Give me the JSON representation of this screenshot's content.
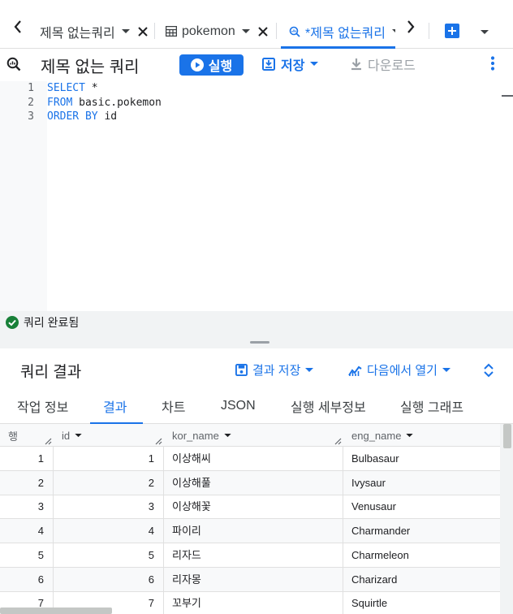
{
  "tabs": [
    {
      "label": "제목 없는쿼리",
      "icon": "none",
      "active": false
    },
    {
      "label": "pokemon",
      "icon": "table-icon",
      "active": false
    },
    {
      "label": "*제목 없는쿼리",
      "icon": "query-icon",
      "active": true
    }
  ],
  "toolbar": {
    "title": "제목 없는 쿼리",
    "run_label": "실행",
    "save_label": "저장",
    "download_label": "다운로드"
  },
  "editor": {
    "lines": [
      {
        "num": "1",
        "tokens": [
          {
            "t": "SELECT",
            "kw": true
          },
          {
            "t": " *",
            "kw": false
          }
        ]
      },
      {
        "num": "2",
        "tokens": [
          {
            "t": "FROM",
            "kw": true
          },
          {
            "t": " basic.pokemon",
            "kw": false
          }
        ]
      },
      {
        "num": "3",
        "tokens": [
          {
            "t": "ORDER BY",
            "kw": true
          },
          {
            "t": " id",
            "kw": false
          }
        ]
      }
    ]
  },
  "status": {
    "text": "쿼리 완료됨"
  },
  "results": {
    "title": "쿼리 결과",
    "save_results_label": "결과 저장",
    "open_in_label": "다음에서 열기",
    "tabs": [
      "작업 정보",
      "결과",
      "차트",
      "JSON",
      "실행 세부정보",
      "실행 그래프"
    ],
    "active_tab": 1,
    "columns": [
      "행",
      "id",
      "kor_name",
      "eng_name"
    ],
    "rows": [
      [
        "1",
        "1",
        "이상해씨",
        "Bulbasaur"
      ],
      [
        "2",
        "2",
        "이상해풀",
        "Ivysaur"
      ],
      [
        "3",
        "3",
        "이상해꽃",
        "Venusaur"
      ],
      [
        "4",
        "4",
        "파이리",
        "Charmander"
      ],
      [
        "5",
        "5",
        "리자드",
        "Charmeleon"
      ],
      [
        "6",
        "6",
        "리자몽",
        "Charizard"
      ],
      [
        "7",
        "7",
        "꼬부기",
        "Squirtle"
      ]
    ]
  },
  "colors": {
    "accent": "#1a73e8",
    "success": "#188038",
    "muted": "#9aa0a6"
  }
}
